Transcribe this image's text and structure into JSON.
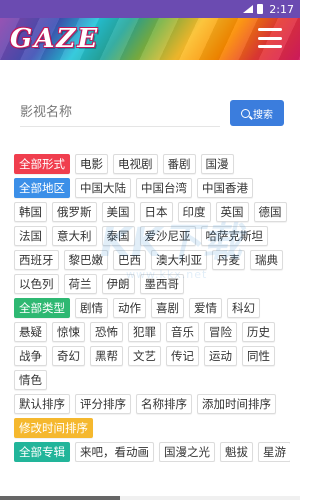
{
  "status_bar": {
    "time": "2:17"
  },
  "header": {
    "logo": "GAZE"
  },
  "search": {
    "placeholder": "影视名称",
    "button_label": "搜索"
  },
  "filters": {
    "form": {
      "all": "全部形式",
      "options": [
        "电影",
        "电视剧",
        "番剧",
        "国漫"
      ]
    },
    "region": {
      "all": "全部地区",
      "options": [
        "中国大陆",
        "中国台湾",
        "中国香港",
        "韩国",
        "俄罗斯",
        "美国",
        "日本",
        "印度",
        "英国",
        "德国",
        "法国",
        "意大利",
        "泰国",
        "爱沙尼亚",
        "哈萨克斯坦",
        "西班牙",
        "黎巴嫩",
        "巴西",
        "澳大利亚",
        "丹麦",
        "瑞典",
        "以色列",
        "荷兰",
        "伊朗",
        "墨西哥"
      ]
    },
    "genre": {
      "all": "全部类型",
      "options": [
        "剧情",
        "动作",
        "喜剧",
        "爱情",
        "科幻",
        "悬疑",
        "惊悚",
        "恐怖",
        "犯罪",
        "音乐",
        "冒险",
        "历史",
        "战争",
        "奇幻",
        "黑帮",
        "文艺",
        "传记",
        "运动",
        "同性",
        "情色"
      ]
    },
    "sort": {
      "options": [
        "默认排序",
        "评分排序",
        "名称排序",
        "添加时间排序"
      ],
      "active": "修改时间排序"
    },
    "album": {
      "all": "全部专辑",
      "options": [
        "来吧，看动画",
        "国漫之光",
        "魁拔",
        "星游"
      ]
    }
  },
  "watermark": {
    "big": "KK下载",
    "small": "www.kkx.net"
  },
  "colors": {
    "red": "#f03e4e",
    "blue": "#3b8fe8",
    "green": "#2eb872",
    "yellow": "#f5b82e",
    "teal": "#22b59a",
    "search_button": "#3b7ddd"
  }
}
